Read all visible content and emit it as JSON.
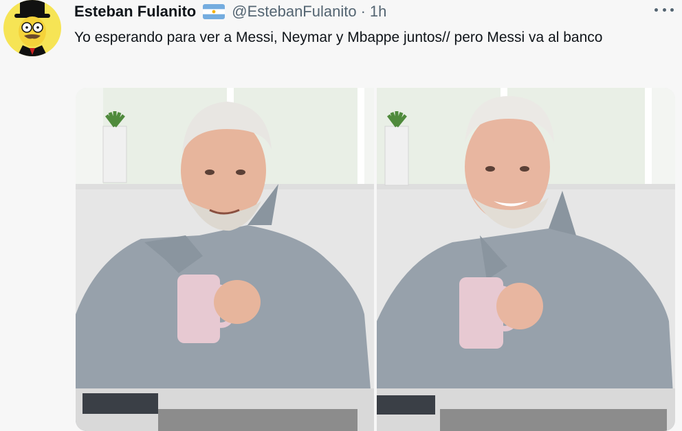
{
  "tweet": {
    "author_name": "Esteban Fulanito",
    "handle": "@EstebanFulanito",
    "separator": "·",
    "time": "1h",
    "text": "Yo esperando para ver a Messi, Neymar y Mbappe juntos// pero Messi va al banco"
  },
  "icons": {
    "verified_flag": "argentina-flag-icon",
    "more": "more-options-icon"
  },
  "colors": {
    "text_primary": "#0f1419",
    "text_secondary": "#536471",
    "background": "#f7f7f7"
  }
}
